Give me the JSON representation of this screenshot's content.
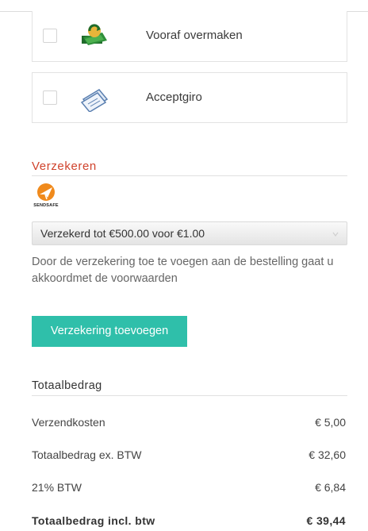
{
  "payment_methods": [
    {
      "label": "Vooraf overmaken",
      "icon": "money-transfer-icon",
      "checked": false
    },
    {
      "label": "Acceptgiro",
      "icon": "giro-check-icon",
      "checked": false
    }
  ],
  "insurance": {
    "title": "Verzekeren",
    "logo_text": "SENDSAFE",
    "select_value": "Verzekerd tot €500.00 voor €1.00",
    "note": "Door de verzekering toe te voegen aan de bestelling gaat u akkoordmet de voorwaarden",
    "button_label": "Verzekering toevoegen"
  },
  "totals": {
    "title": "Totaalbedrag",
    "rows": [
      {
        "label": "Verzendkosten",
        "value": "€ 5,00"
      },
      {
        "label": "Totaalbedrag ex. BTW",
        "value": "€ 32,60"
      },
      {
        "label": "21% BTW",
        "value": "€ 6,84"
      }
    ],
    "grand_total": {
      "label": "Totaalbedrag incl. btw",
      "value": "€ 39,44"
    }
  },
  "colors": {
    "accent_red": "#d0432c",
    "button_teal": "#2fbfaa",
    "sendsafe_orange": "#f08a1c"
  }
}
